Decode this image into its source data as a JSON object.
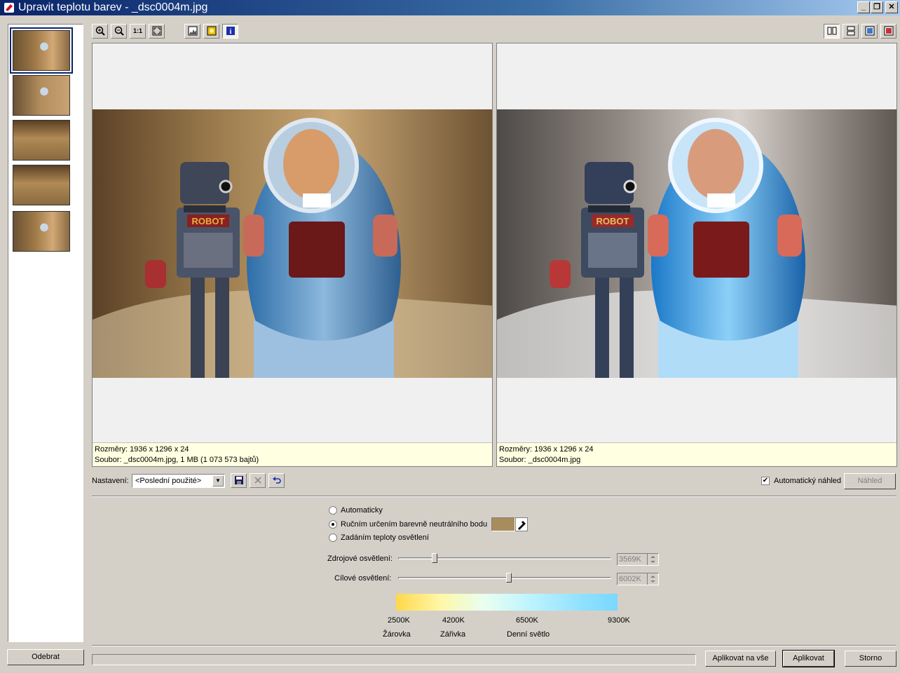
{
  "window": {
    "title": "Upravit teplotu barev - _dsc0004m.jpg",
    "minimize": "_",
    "restore": "❐",
    "close": "✕"
  },
  "thumbnails": [
    {
      "name": "robot-1"
    },
    {
      "name": "robot-2"
    },
    {
      "name": "outlet-1"
    },
    {
      "name": "outlet-2"
    },
    {
      "name": "robot-3"
    }
  ],
  "toolbar": {
    "zoom_in": "zoom-in-icon",
    "zoom_out": "zoom-out-icon",
    "actual_size": "1:1",
    "fit": "fit-icon",
    "histogram": "histogram-icon",
    "highlight": "highlight-icon",
    "info": "i"
  },
  "left_panel": {
    "dimensions": "Rozměry: 1936 x 1296 x 24",
    "file": "Soubor: _dsc0004m.jpg, 1 MB (1 073 573 bajtů)"
  },
  "right_panel": {
    "dimensions": "Rozměry: 1936 x 1296 x 24",
    "file": "Soubor: _dsc0004m.jpg"
  },
  "settings": {
    "label": "Nastavení:",
    "selected": "<Poslední použité>"
  },
  "auto_preview": {
    "label": "Automatický náhled",
    "checked": true
  },
  "preview_button": "Náhled",
  "options": {
    "automatic": "Automaticky",
    "manual": "Ručním určením barevně neutrálního bodu",
    "temperature": "Zadáním teploty osvětlení",
    "picked_color": "#a88c5e"
  },
  "source_light": {
    "label": "Zdrojové osvětlení:",
    "value": "3569K",
    "fraction": 0.17
  },
  "target_light": {
    "label": "Cílové osvětlení:",
    "value": "6002K",
    "fraction": 0.52
  },
  "scale": {
    "ticks": [
      "2500K",
      "4200K",
      "6500K",
      "9300K"
    ],
    "names": [
      "Žárovka",
      "Zářivka",
      "Denní světlo"
    ]
  },
  "buttons": {
    "remove": "Odebrat",
    "apply_all": "Aplikovat na vše",
    "apply": "Aplikovat",
    "cancel": "Storno"
  }
}
